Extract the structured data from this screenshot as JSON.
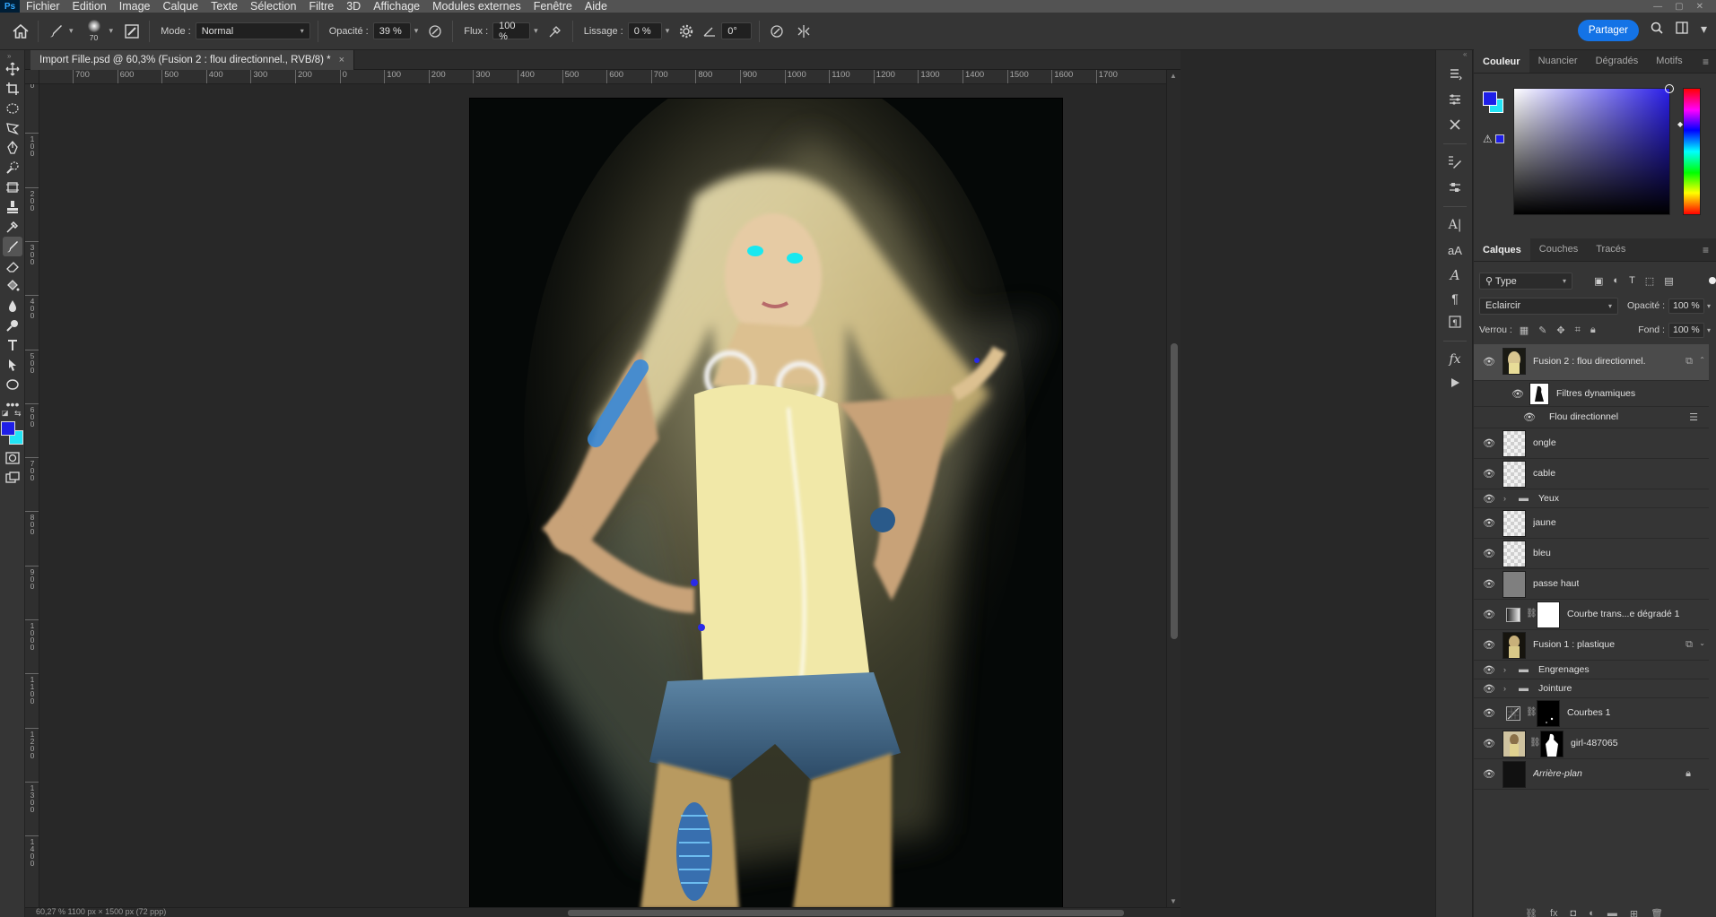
{
  "menu": {
    "logo": "Ps",
    "items": [
      "Fichier",
      "Edition",
      "Image",
      "Calque",
      "Texte",
      "Sélection",
      "Filtre",
      "3D",
      "Affichage",
      "Modules externes",
      "Fenêtre",
      "Aide"
    ]
  },
  "options": {
    "brush_size": "70",
    "mode_label": "Mode :",
    "mode_value": "Normal",
    "opacity_label": "Opacité :",
    "opacity_value": "39 %",
    "flow_label": "Flux :",
    "flow_value": "100 %",
    "smoothing_label": "Lissage :",
    "smoothing_value": "0 %",
    "angle_value": "0°",
    "share_label": "Partager"
  },
  "document": {
    "tab_title": "Import Fille.psd @ 60,3% (Fusion 2 : flou directionnel., RVB/8) *",
    "close": "×",
    "status": "60,27 %     1100 px × 1500 px (72 ppp)"
  },
  "rulers": {
    "horizontal": [
      "700",
      "600",
      "500",
      "400",
      "300",
      "200",
      "0",
      "100",
      "200",
      "300",
      "400",
      "500",
      "600",
      "700",
      "800",
      "900",
      "1000",
      "1100",
      "1200",
      "1300",
      "1400",
      "1500",
      "1600",
      "1700"
    ],
    "vertical": [
      "0",
      "100",
      "200",
      "300",
      "400",
      "500",
      "600",
      "700",
      "800",
      "900",
      "1000",
      "1100",
      "1200",
      "1300",
      "1400"
    ]
  },
  "color_panel": {
    "tabs": [
      "Couleur",
      "Nuancier",
      "Dégradés",
      "Motifs"
    ],
    "foreground": "#1e1ee8",
    "background": "#22e4f5"
  },
  "layers_panel": {
    "tabs": [
      "Calques",
      "Couches",
      "Tracés"
    ],
    "filter_type": "Type",
    "blend_mode": "Eclaircir",
    "opacity_label": "Opacité :",
    "opacity_value": "100 %",
    "lock_label": "Verrou :",
    "fill_label": "Fond :",
    "fill_value": "100 %",
    "layers": [
      {
        "name": "Fusion 2 : flou directionnel."
      },
      {
        "name": "Filtres dynamiques"
      },
      {
        "name": "Flou directionnel"
      },
      {
        "name": "ongle"
      },
      {
        "name": "cable"
      },
      {
        "name": "Yeux"
      },
      {
        "name": "jaune"
      },
      {
        "name": "bleu"
      },
      {
        "name": "passe haut"
      },
      {
        "name": "Courbe trans...e dégradé 1"
      },
      {
        "name": "Fusion 1 : plastique"
      },
      {
        "name": "Engrenages"
      },
      {
        "name": "Jointure"
      },
      {
        "name": "Courbes 1"
      },
      {
        "name": "girl-487065"
      },
      {
        "name": "Arrière-plan"
      }
    ]
  },
  "icons": {
    "home": "home-icon",
    "brush": "brush-icon",
    "airbrush": "airbrush-icon",
    "settings": "gear-icon",
    "search": "search-icon"
  }
}
